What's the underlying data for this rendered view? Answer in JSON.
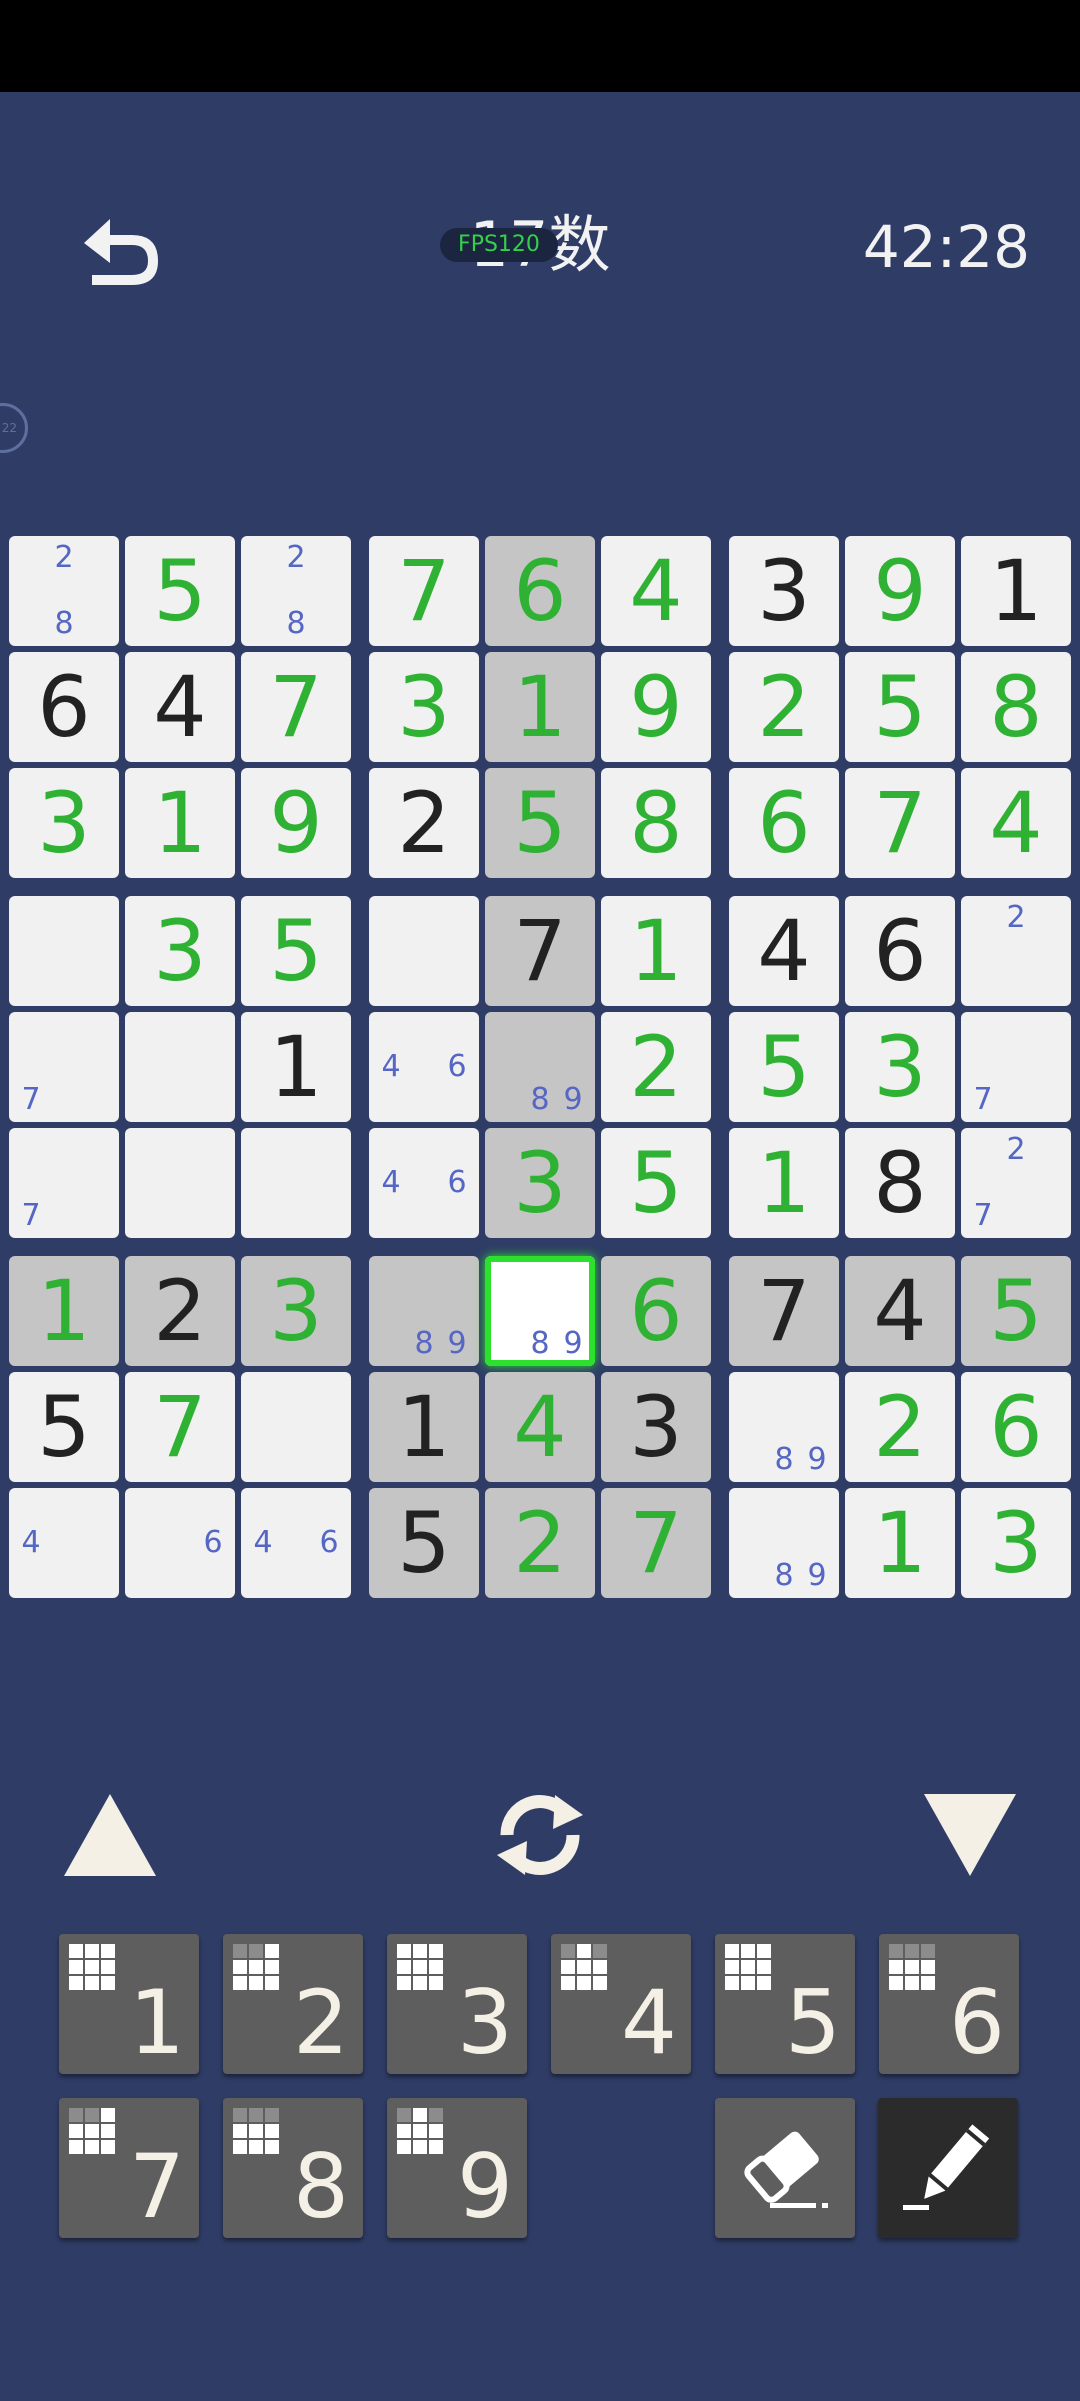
{
  "header": {
    "title": "17数",
    "fps_badge": "FPS120",
    "timer": "42:28",
    "bubble_text": "22"
  },
  "board": {
    "selected": [
      6,
      4
    ],
    "cells": [
      [
        {
          "notes": [
            2,
            8
          ]
        },
        {
          "v": 5,
          "c": "g"
        },
        {
          "notes": [
            2,
            8
          ]
        },
        {
          "v": 7,
          "c": "g"
        },
        {
          "v": 6,
          "c": "g"
        },
        {
          "v": 4,
          "c": "g"
        },
        {
          "v": 3,
          "c": "k"
        },
        {
          "v": 9,
          "c": "g"
        },
        {
          "v": 1,
          "c": "k"
        }
      ],
      [
        {
          "v": 6,
          "c": "k"
        },
        {
          "v": 4,
          "c": "k"
        },
        {
          "v": 7,
          "c": "g"
        },
        {
          "v": 3,
          "c": "g"
        },
        {
          "v": 1,
          "c": "g"
        },
        {
          "v": 9,
          "c": "g"
        },
        {
          "v": 2,
          "c": "g"
        },
        {
          "v": 5,
          "c": "g"
        },
        {
          "v": 8,
          "c": "g"
        }
      ],
      [
        {
          "v": 3,
          "c": "g"
        },
        {
          "v": 1,
          "c": "g"
        },
        {
          "v": 9,
          "c": "g"
        },
        {
          "v": 2,
          "c": "k"
        },
        {
          "v": 5,
          "c": "g"
        },
        {
          "v": 8,
          "c": "g"
        },
        {
          "v": 6,
          "c": "g"
        },
        {
          "v": 7,
          "c": "g"
        },
        {
          "v": 4,
          "c": "g"
        }
      ],
      [
        {
          "notes": []
        },
        {
          "v": 3,
          "c": "g"
        },
        {
          "v": 5,
          "c": "g"
        },
        {
          "notes": []
        },
        {
          "v": 7,
          "c": "k"
        },
        {
          "v": 1,
          "c": "g"
        },
        {
          "v": 4,
          "c": "k"
        },
        {
          "v": 6,
          "c": "k"
        },
        {
          "notes": [
            2
          ]
        }
      ],
      [
        {
          "notes": [
            7
          ]
        },
        {
          "notes": []
        },
        {
          "v": 1,
          "c": "k"
        },
        {
          "notes": [
            4,
            6
          ]
        },
        {
          "notes": [
            8,
            9
          ]
        },
        {
          "v": 2,
          "c": "g"
        },
        {
          "v": 5,
          "c": "g"
        },
        {
          "v": 3,
          "c": "g"
        },
        {
          "notes": [
            7
          ]
        }
      ],
      [
        {
          "notes": [
            7
          ]
        },
        {
          "notes": []
        },
        {
          "notes": []
        },
        {
          "notes": [
            4,
            6
          ]
        },
        {
          "v": 3,
          "c": "g"
        },
        {
          "v": 5,
          "c": "g"
        },
        {
          "v": 1,
          "c": "g"
        },
        {
          "v": 8,
          "c": "k"
        },
        {
          "notes": [
            2,
            7
          ]
        }
      ],
      [
        {
          "v": 1,
          "c": "g"
        },
        {
          "v": 2,
          "c": "k"
        },
        {
          "v": 3,
          "c": "g"
        },
        {
          "notes": [
            8,
            9
          ]
        },
        {
          "notes": [
            8,
            9
          ]
        },
        {
          "v": 6,
          "c": "g"
        },
        {
          "v": 7,
          "c": "k"
        },
        {
          "v": 4,
          "c": "k"
        },
        {
          "v": 5,
          "c": "g"
        }
      ],
      [
        {
          "v": 5,
          "c": "k"
        },
        {
          "v": 7,
          "c": "g"
        },
        {
          "notes": []
        },
        {
          "v": 1,
          "c": "k"
        },
        {
          "v": 4,
          "c": "g"
        },
        {
          "v": 3,
          "c": "k"
        },
        {
          "notes": [
            8,
            9
          ]
        },
        {
          "v": 2,
          "c": "g"
        },
        {
          "v": 6,
          "c": "g"
        }
      ],
      [
        {
          "notes": [
            4
          ]
        },
        {
          "notes": [
            6
          ]
        },
        {
          "notes": [
            4,
            6
          ]
        },
        {
          "v": 5,
          "c": "k"
        },
        {
          "v": 2,
          "c": "g"
        },
        {
          "v": 7,
          "c": "g"
        },
        {
          "notes": [
            8,
            9
          ]
        },
        {
          "v": 1,
          "c": "g"
        },
        {
          "v": 3,
          "c": "g"
        }
      ]
    ],
    "highlight_col": 4,
    "highlight_row": 6,
    "highlight_box": [
      6,
      3
    ]
  },
  "controls": {
    "up_icon": "triangle-up-icon",
    "refresh_icon": "refresh-icon",
    "down_icon": "triangle-down-icon"
  },
  "keypad": {
    "keys": [
      {
        "label": "1",
        "off": []
      },
      {
        "label": "2",
        "off": [
          0,
          1
        ]
      },
      {
        "label": "3",
        "off": []
      },
      {
        "label": "4",
        "off": [
          0,
          2
        ]
      },
      {
        "label": "5",
        "off": []
      },
      {
        "label": "6",
        "off": [
          0,
          1,
          2
        ]
      },
      {
        "label": "7",
        "off": [
          0,
          1
        ]
      },
      {
        "label": "8",
        "off": [
          0,
          1,
          2
        ]
      },
      {
        "label": "9",
        "off": [
          0,
          2
        ]
      }
    ],
    "eraser_icon": "eraser-icon",
    "pencil_icon": "pencil-icon",
    "colors": {
      "key_bg": "#5e5e5e",
      "pencil_bg": "#2b2b2b",
      "given": "#222222",
      "entered": "#2fb233",
      "note": "#5566c4",
      "select": "#2ee02e"
    }
  }
}
